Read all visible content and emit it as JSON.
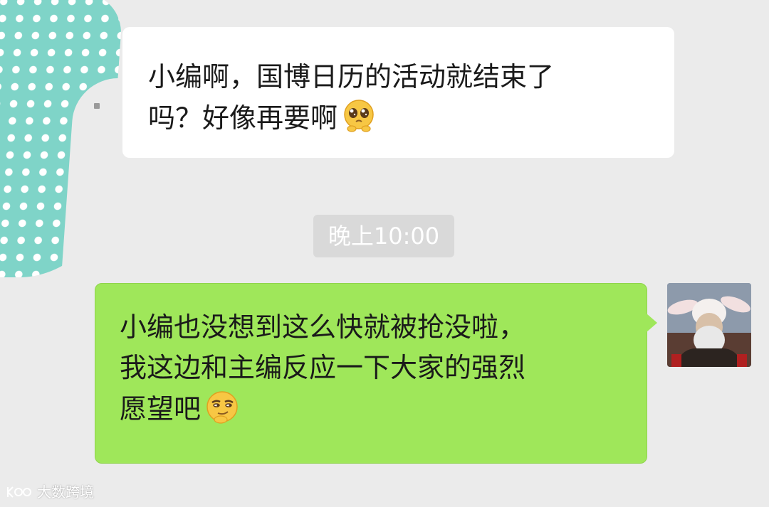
{
  "incoming_message": {
    "lines": [
      "小编啊，国博日历的活动就结束了",
      "吗？好像再要啊"
    ],
    "emoji": "pleading-face-emoji"
  },
  "timestamp": "晚上10:00",
  "outgoing_message": {
    "lines": [
      "小编也没想到这么快就被抢没啦，",
      "我这边和主编反应一下大家的强烈",
      "愿望吧"
    ],
    "emoji": "smirk-thinking-emoji"
  },
  "watermark": "大数跨境",
  "colors": {
    "background": "#ebebeb",
    "incoming_bubble": "#ffffff",
    "outgoing_bubble": "#9fe75a",
    "timestamp_pill": "#d9d9d9",
    "left_avatar": "#7fd4c8"
  }
}
